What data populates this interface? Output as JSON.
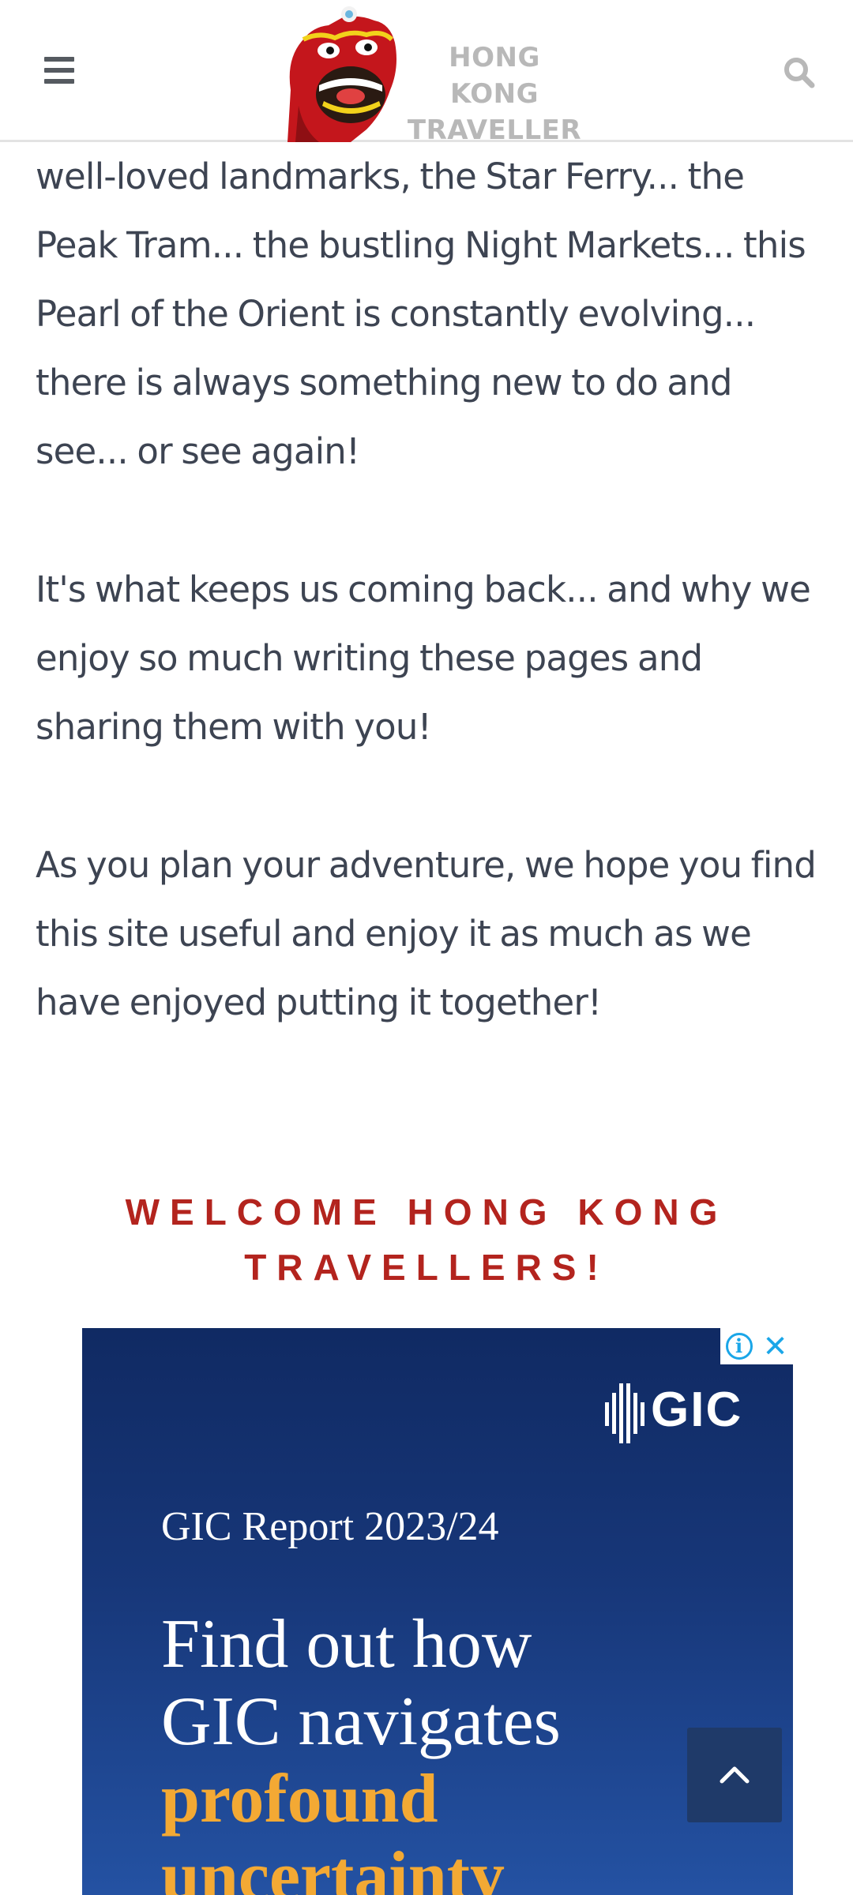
{
  "header": {
    "menu_icon": "hamburger-icon",
    "logo_line1": "HONG KONG",
    "logo_line2": "TRAVELLER",
    "search_icon": "search-icon"
  },
  "article": {
    "paragraph1": "well-loved landmarks, the Star Ferry... the Peak Tram... the bustling Night Markets... this Pearl of the Orient is constantly evolving... there is always something new to do and see... or see again!",
    "paragraph2": "It's what keeps us coming back... and why we enjoy so much writing these pages and sharing them with you!",
    "paragraph3": "As you plan your adventure, we hope you find this site useful and enjoy it as much as we have enjoyed putting it together!"
  },
  "welcome": {
    "line1": "WELCOME HONG KONG",
    "line2": "TRAVELLERS!"
  },
  "ad": {
    "info_icon": "ad-info-icon",
    "close_icon": "ad-close-icon",
    "brand": "GIC",
    "report": "GIC Report 2023/24",
    "headline_line1": "Find out how",
    "headline_line2": "GIC navigates",
    "headline_line3": "profound",
    "headline_line4": "uncertainty",
    "background_color": "#173779",
    "highlight_color": "#f3a934"
  },
  "back_to_top": {
    "icon": "chevron-up-icon"
  },
  "colors": {
    "heading_red": "#b3241e",
    "body_text": "#3d4452",
    "logo_grey": "#b8b8b8",
    "to_top_bg": "#1f3a69"
  }
}
